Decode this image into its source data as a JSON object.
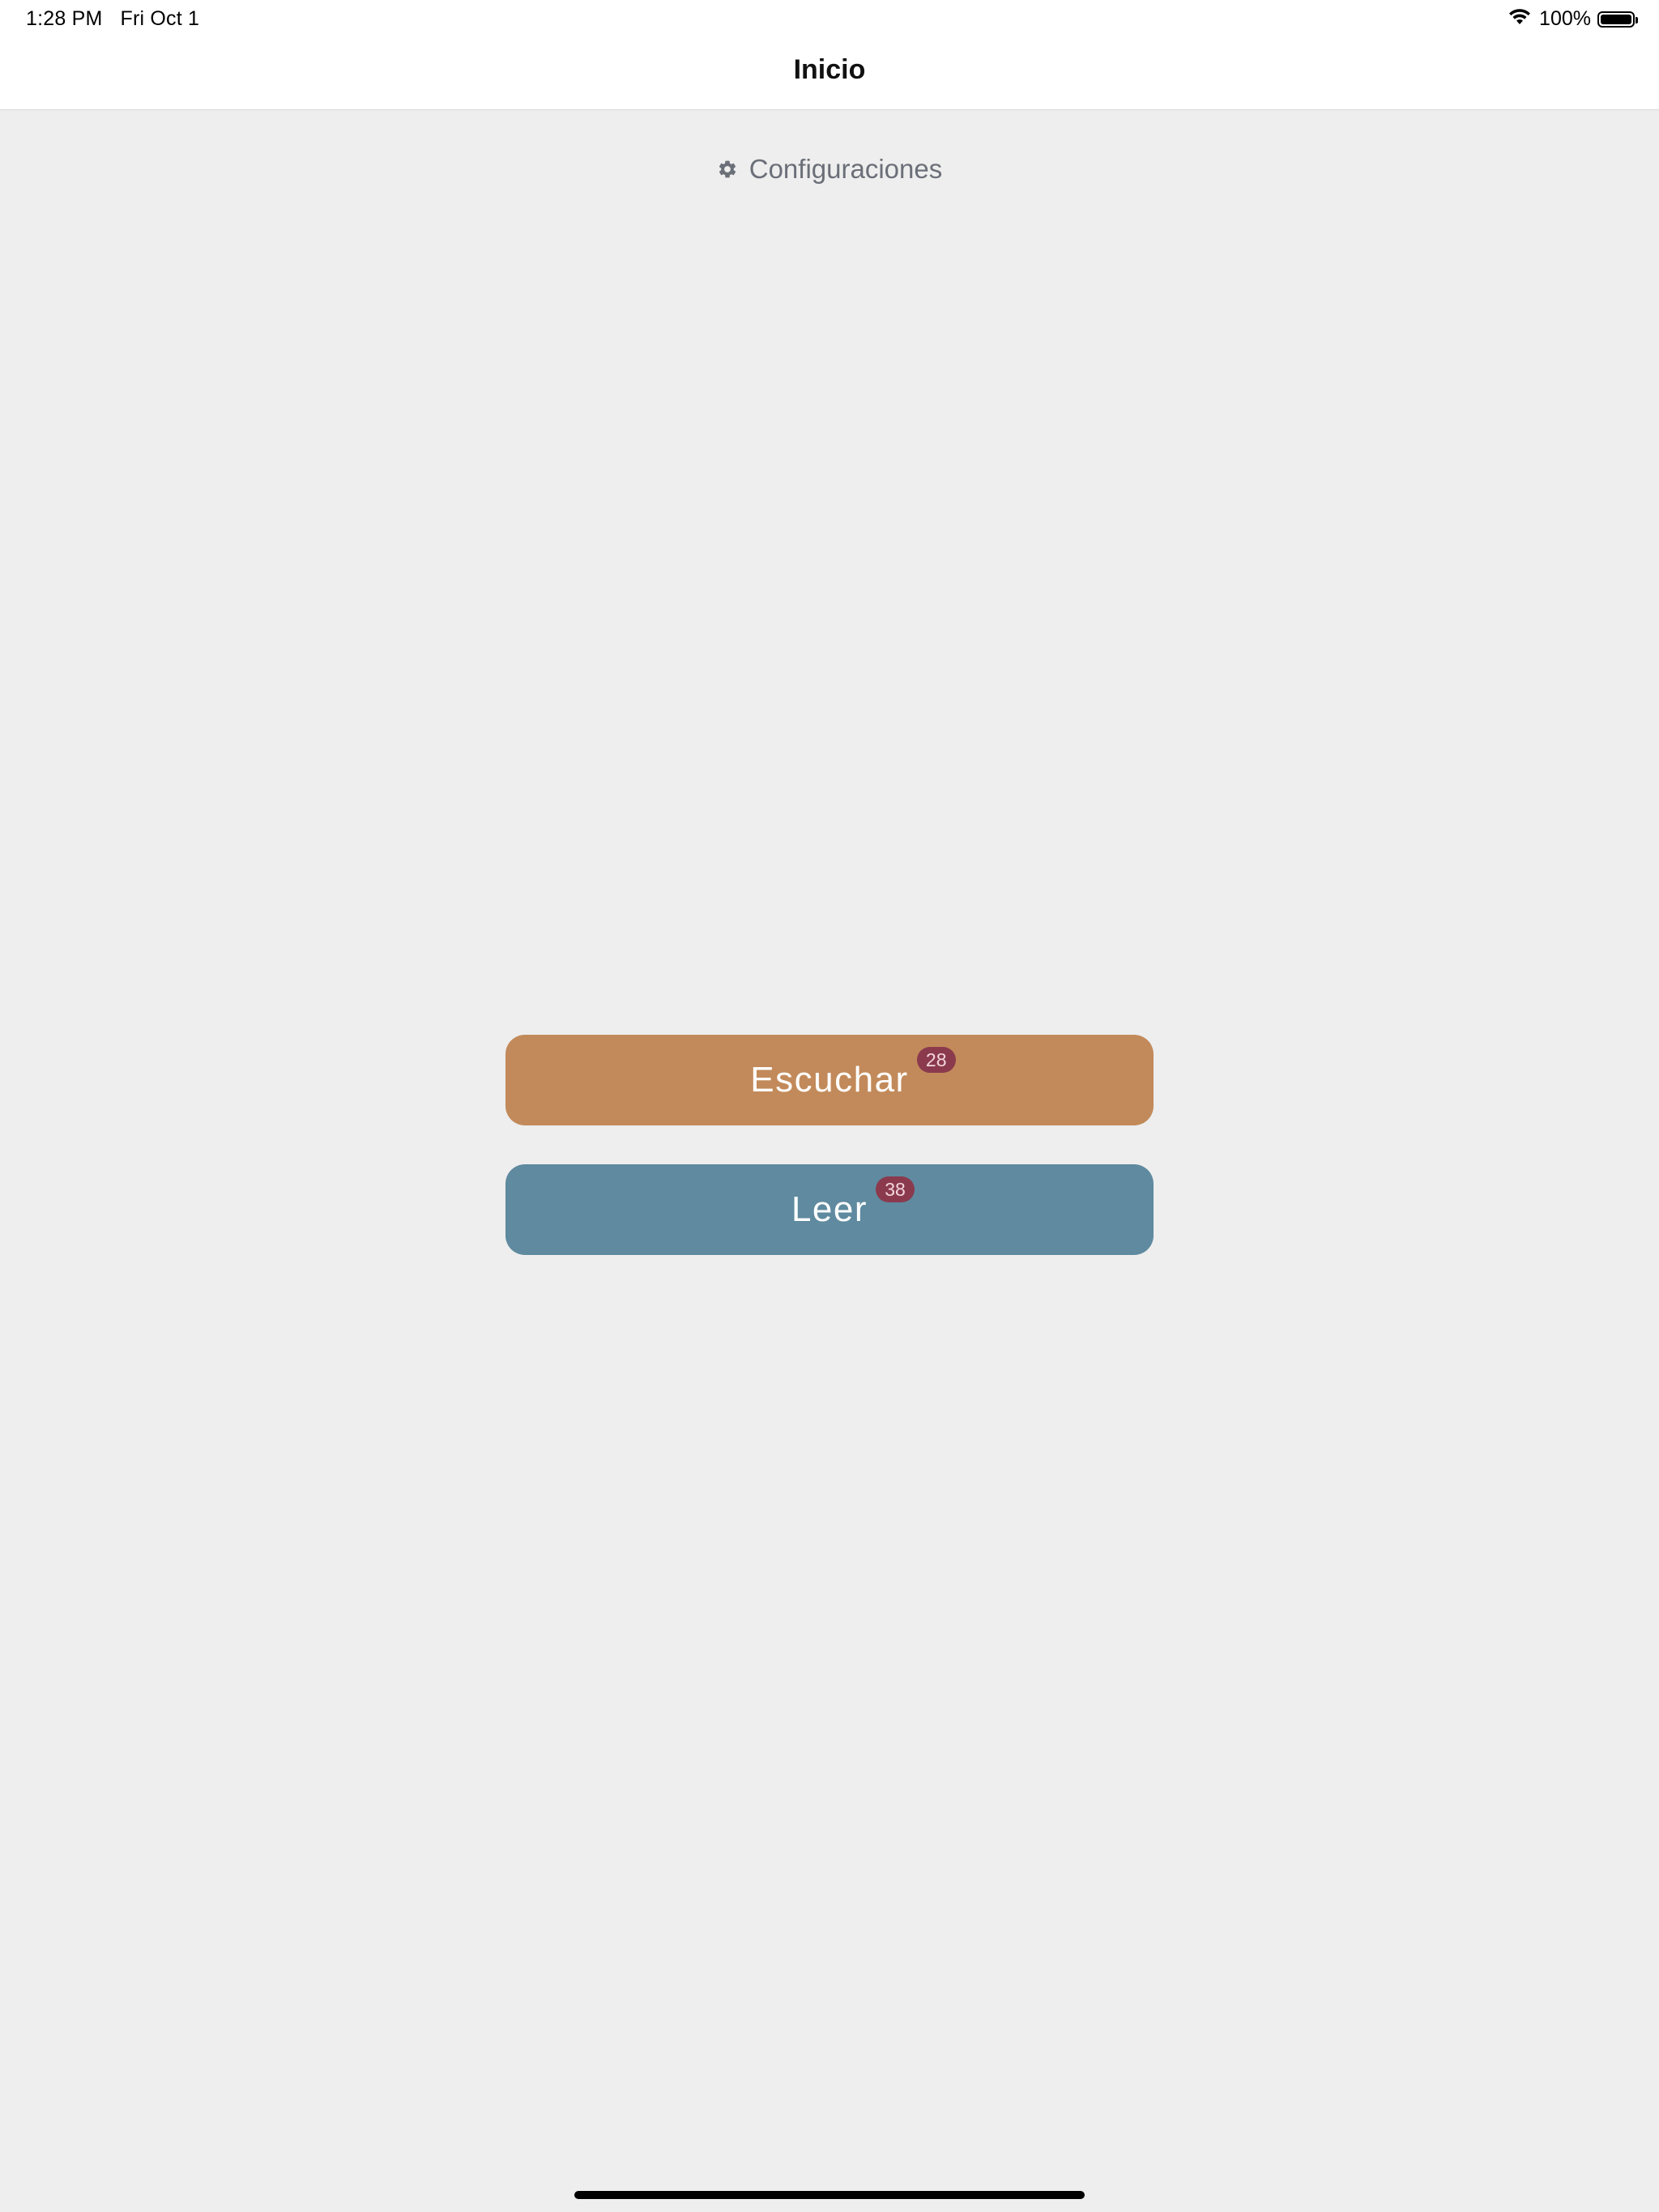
{
  "status_bar": {
    "time": "1:28 PM",
    "date": "Fri Oct 1",
    "battery": "100%"
  },
  "nav": {
    "title": "Inicio"
  },
  "settings": {
    "label": "Configuraciones",
    "icon": "gear-icon"
  },
  "buttons": [
    {
      "label": "Escuchar",
      "badge": "28",
      "color": "#c28a5a"
    },
    {
      "label": "Leer",
      "badge": "38",
      "color": "#5f8a9f"
    }
  ],
  "colors": {
    "background": "#eeeeee",
    "badge": "#8b3a4e",
    "settings_text": "#6b6f78"
  }
}
